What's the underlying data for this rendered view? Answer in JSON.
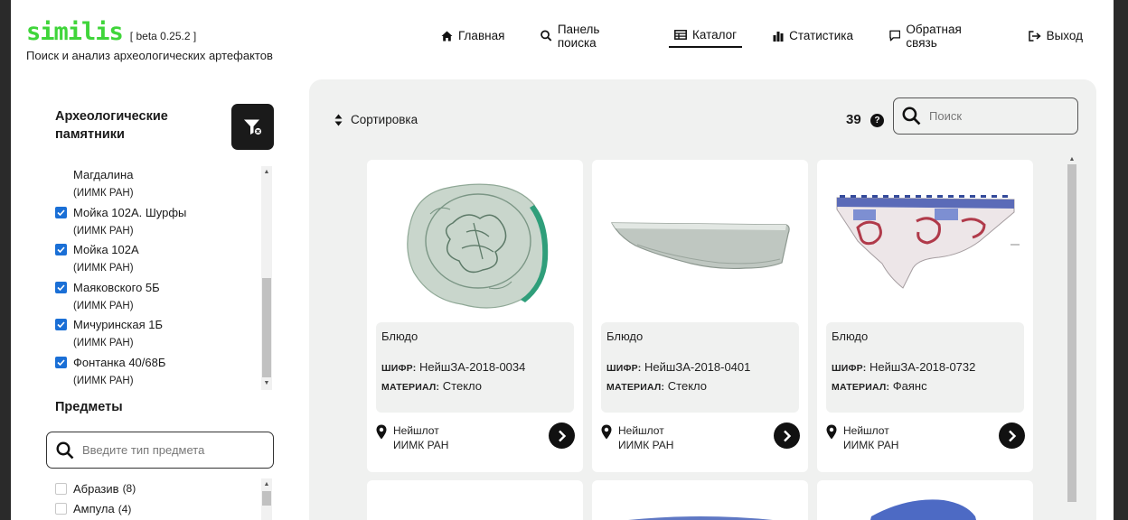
{
  "app": {
    "logo": "similis",
    "version": "[ beta 0.25.2 ]",
    "tagline": "Поиск и анализ археологических артефактов"
  },
  "nav": [
    {
      "label": "Главная",
      "icon": "home-icon"
    },
    {
      "label": "Панель поиска",
      "icon": "search-icon"
    },
    {
      "label": "Каталог",
      "icon": "table-icon",
      "active": true
    },
    {
      "label": "Статистика",
      "icon": "bar-chart-icon"
    },
    {
      "label": "Обратная связь",
      "icon": "chat-icon"
    },
    {
      "label": "Выход",
      "icon": "logout-icon"
    }
  ],
  "sidebar": {
    "sites_title": "Археологические памятники",
    "sites": [
      {
        "name": "Магдалина",
        "org": "(ИИМК РАН)",
        "checked": null
      },
      {
        "name": "Мойка 102А. Шурфы",
        "org": "(ИИМК РАН)",
        "checked": true
      },
      {
        "name": "Мойка 102А",
        "org": "(ИИМК РАН)",
        "checked": true
      },
      {
        "name": "Маяковского 5Б",
        "org": "(ИИМК РАН)",
        "checked": true
      },
      {
        "name": "Мичуринская 1Б",
        "org": "(ИИМК РАН)",
        "checked": true
      },
      {
        "name": "Фонтанка 40/68Б",
        "org": "(ИИМК РАН)",
        "checked": true
      }
    ],
    "items_title": "Предметы",
    "items_search_placeholder": "Введите тип предмета",
    "items": [
      {
        "name": "Абразив",
        "count": "(8)"
      },
      {
        "name": "Ампула",
        "count": "(4)"
      }
    ]
  },
  "toolbar": {
    "sort_label": "Сортировка",
    "result_count": "39",
    "help": "?",
    "search_placeholder": "Поиск"
  },
  "cards": [
    {
      "title": "Блюдо",
      "code_key": "ШИФР:",
      "code": "НейшЗА-2018-0034",
      "material_key": "МАТЕРИАЛ:",
      "material": "Стекло",
      "loc1": "Нейшлот",
      "loc2": "ИИМК РАН"
    },
    {
      "title": "Блюдо",
      "code_key": "ШИФР:",
      "code": "НейшЗА-2018-0401",
      "material_key": "МАТЕРИАЛ:",
      "material": "Стекло",
      "loc1": "Нейшлот",
      "loc2": "ИИМК РАН"
    },
    {
      "title": "Блюдо",
      "code_key": "ШИФР:",
      "code": "НейшЗА-2018-0732",
      "material_key": "МАТЕРИАЛ:",
      "material": "Фаянс",
      "loc1": "Нейшлот",
      "loc2": "ИИМК РАН"
    }
  ],
  "colors": {
    "brand": "#3fd53a",
    "checkbox": "#1a6fd6",
    "panel": "#f0f1f0"
  }
}
